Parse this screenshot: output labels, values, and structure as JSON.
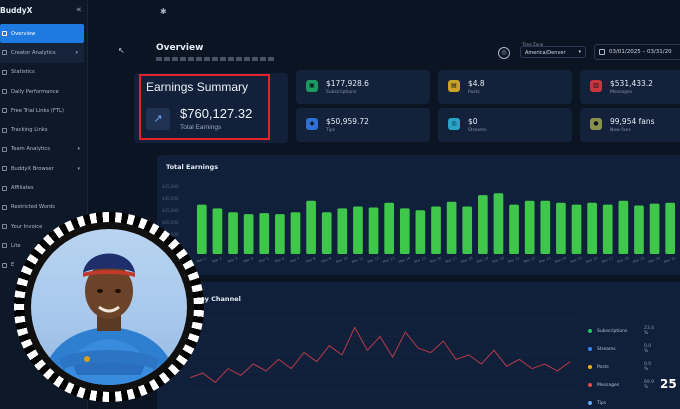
{
  "sidebar": {
    "brand": "BuddyX",
    "collapse_icon": "«",
    "items": [
      {
        "label": "Overview",
        "active": true
      },
      {
        "label": "Creator Analytics",
        "group": true
      },
      {
        "label": "Statistics"
      },
      {
        "label": "Daily Performance"
      },
      {
        "label": "Free Trial Links (FTL)"
      },
      {
        "label": "Tracking Links"
      },
      {
        "label": "Team Analytics"
      },
      {
        "label": "BuddyX Browser"
      },
      {
        "label": "Affiliates"
      },
      {
        "label": "Restricted Words"
      },
      {
        "label": "Your Invoice"
      },
      {
        "label": "Lite"
      },
      {
        "label": "E"
      }
    ]
  },
  "header": {
    "title": "Overview",
    "timezone_label": "Time Zone",
    "timezone_value": "America/Denver",
    "date_range": "03/01/2025 – 03/31/20"
  },
  "earnings_summary": {
    "title": "Earnings Summary",
    "value": "$760,127.32",
    "label": "Total Earnings"
  },
  "stats": [
    {
      "value": "$177,928.6",
      "label": "Subscriptions",
      "color": "#1b9b5f"
    },
    {
      "value": "$4.8",
      "label": "Posts",
      "color": "#c9a227"
    },
    {
      "value": "$531,433.2",
      "label": "Messages",
      "color": "#c9353a"
    },
    {
      "value": "$50,959.72",
      "label": "Tips",
      "color": "#2f6fd6"
    },
    {
      "value": "$0",
      "label": "Streams",
      "color": "#2aa3c9"
    },
    {
      "value": "99,954 fans",
      "label": "New fans",
      "color": "#8a8f4a"
    }
  ],
  "total_earnings": {
    "title": "Total Earnings"
  },
  "channel": {
    "title": "by Channel",
    "legend": [
      {
        "name": "Subscriptions",
        "pct": "23.4 %",
        "color": "#22c55e"
      },
      {
        "name": "Streams",
        "pct": "0.0 %",
        "color": "#3b82f6"
      },
      {
        "name": "Posts",
        "pct": "0.0 %",
        "color": "#eab308"
      },
      {
        "name": "Messages",
        "pct": "69.9 %",
        "color": "#ef4444"
      },
      {
        "name": "Tips",
        "pct": "",
        "color": "#60a5fa"
      }
    ]
  },
  "chart_data": [
    {
      "type": "bar",
      "title": "Total Earnings",
      "ylim": [
        0,
        40000
      ],
      "yticks": [
        "$35,000",
        "$30,000",
        "$25,000",
        "$20,000",
        "$15,000",
        "$10,000"
      ],
      "categories": [
        "Mar 1",
        "Mar 2",
        "Mar 3",
        "Mar 4",
        "Mar 5",
        "Mar 6",
        "Mar 7",
        "Mar 8",
        "Mar 9",
        "Mar 10",
        "Mar 11",
        "Mar 12",
        "Mar 13",
        "Mar 14",
        "Mar 15",
        "Mar 16",
        "Mar 17",
        "Mar 18",
        "Mar 19",
        "Mar 20",
        "Mar 21",
        "Mar 22",
        "Mar 23",
        "Mar 24",
        "Mar 25",
        "Mar 26",
        "Mar 27",
        "Mar 28",
        "Mar 29",
        "Mar 30",
        "Mar 31"
      ],
      "values": [
        26000,
        24000,
        22000,
        21000,
        21500,
        21000,
        22000,
        28000,
        22000,
        24000,
        25000,
        24500,
        27000,
        24000,
        23000,
        25000,
        27500,
        25000,
        31000,
        32000,
        26000,
        28000,
        28000,
        27000,
        26000,
        27000,
        26000,
        28000,
        25500,
        26500,
        27000
      ],
      "bar_color": "#3ec74a"
    },
    {
      "type": "line",
      "title": "by Channel",
      "x": [
        1,
        2,
        3,
        4,
        5,
        6,
        7,
        8,
        9,
        10,
        11,
        12,
        13,
        14,
        15,
        16,
        17,
        18,
        19,
        20,
        21,
        22,
        23,
        24,
        25,
        26,
        27,
        28,
        29,
        30,
        31
      ],
      "series": [
        {
          "name": "Messages",
          "values": [
            8,
            10,
            6,
            12,
            9,
            14,
            11,
            16,
            12,
            19,
            15,
            22,
            18,
            30,
            20,
            26,
            17,
            28,
            21,
            19,
            24,
            16,
            18,
            14,
            20,
            13,
            16,
            12,
            14,
            11,
            15
          ],
          "color": "#b83a46"
        }
      ],
      "ylim": [
        0,
        35
      ]
    }
  ],
  "badge": "25"
}
